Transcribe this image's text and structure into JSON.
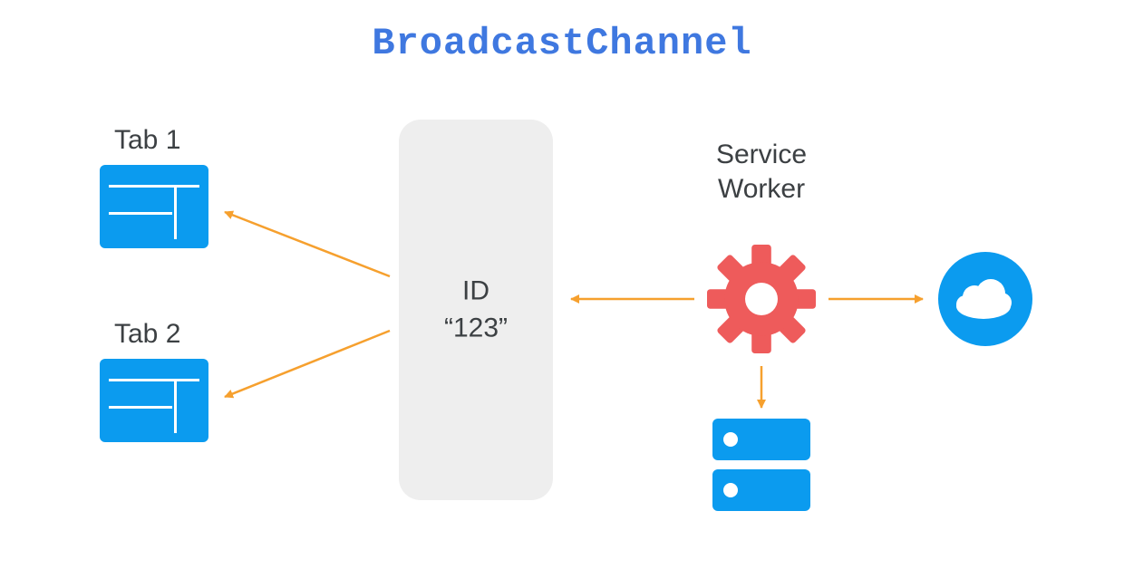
{
  "title": "BroadcastChannel",
  "tabs": [
    {
      "label": "Tab 1"
    },
    {
      "label": "Tab 2"
    }
  ],
  "channel": {
    "id_label": "ID",
    "id_value": "“123”"
  },
  "service_worker": {
    "label_line1": "Service",
    "label_line2": "Worker"
  },
  "icons": {
    "tab": "browser-tab-icon",
    "gear": "gear-icon",
    "cloud": "cloud-icon",
    "storage": "storage-icon"
  },
  "colors": {
    "accent_blue": "#0b9bef",
    "title_blue": "#3f78e0",
    "gear_red": "#ee5b5b",
    "arrow_orange": "#f6a02e",
    "channel_bg": "#eeeeee",
    "text": "#3c4043"
  },
  "arrows": [
    {
      "from": "channel",
      "to": "tab-1"
    },
    {
      "from": "channel",
      "to": "tab-2"
    },
    {
      "from": "service-worker",
      "to": "channel"
    },
    {
      "from": "service-worker",
      "to": "cloud"
    },
    {
      "from": "service-worker",
      "to": "storage"
    }
  ]
}
